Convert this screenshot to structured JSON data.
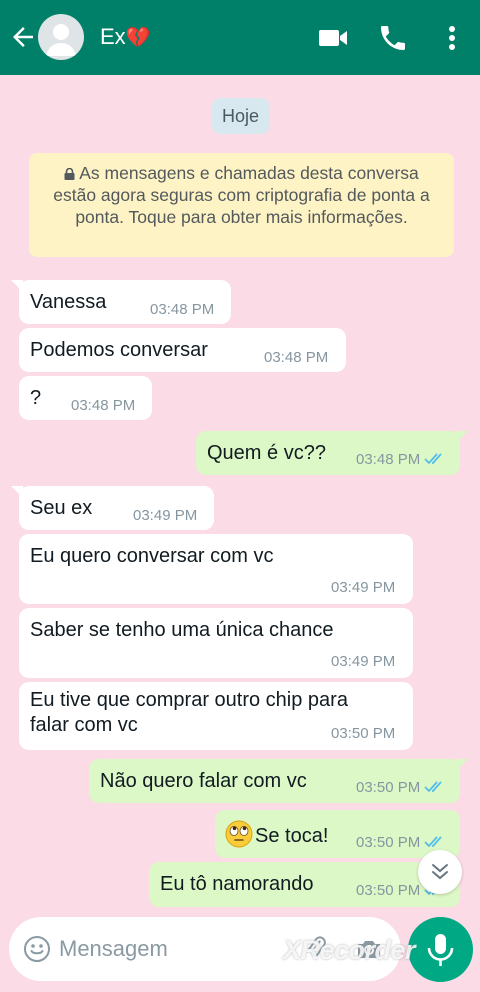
{
  "header": {
    "contact_name": "Ex",
    "contact_emoji": "💔",
    "icons": [
      "back-arrow-icon",
      "avatar",
      "video-call-icon",
      "voice-call-icon",
      "more-options-icon"
    ]
  },
  "date_chip": "Hoje",
  "encryption_notice": "As mensagens e chamadas desta conversa estão agora seguras com criptografia de ponta a ponta. Toque para obter mais informações.",
  "messages": [
    {
      "direction": "in",
      "text": "Vanessa",
      "time": "03:48 PM"
    },
    {
      "direction": "in",
      "text": "Podemos conversar",
      "time": "03:48 PM"
    },
    {
      "direction": "in",
      "text": "?",
      "time": "03:48 PM"
    },
    {
      "direction": "out",
      "text": "Quem é vc??",
      "time": "03:48 PM",
      "status": "read"
    },
    {
      "direction": "in",
      "text": "Seu ex",
      "time": "03:49 PM"
    },
    {
      "direction": "in",
      "text": "Eu quero conversar com vc",
      "time": "03:49 PM"
    },
    {
      "direction": "in",
      "text": "Saber se tenho uma única chance",
      "time": "03:49 PM"
    },
    {
      "direction": "in",
      "text_line1": "Eu tive que comprar outro chip para",
      "text_line2": "falar com vc",
      "time": "03:50 PM"
    },
    {
      "direction": "out",
      "text": "Não quero falar com vc",
      "time": "03:50 PM",
      "status": "read"
    },
    {
      "direction": "out",
      "emoji": "🙄",
      "text": "Se toca!",
      "time": "03:50 PM",
      "status": "read"
    },
    {
      "direction": "out",
      "text": "Eu tô namorando",
      "time": "03:50 PM",
      "status": "read"
    }
  ],
  "composer": {
    "placeholder": "Mensagem",
    "icons": [
      "emoji-icon",
      "attach-icon",
      "camera-icon",
      "mic-icon"
    ]
  },
  "watermark": "XRecorder",
  "colors": {
    "header": "#008069",
    "chat_background": "#fadbe6",
    "incoming_bubble": "#ffffff",
    "outgoing_bubble": "#dcf8c6",
    "read_ticks": "#53bdeb",
    "mic_button": "#00a884"
  }
}
